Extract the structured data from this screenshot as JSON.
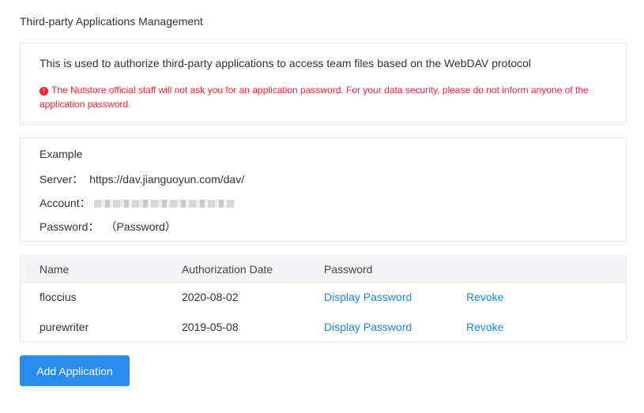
{
  "page": {
    "title": "Third-party Applications Management"
  },
  "info": {
    "description": "This is used to authorize third-party applications to access team files based on the WebDAV protocol",
    "warning": "The Nutstore official staff will not ask you for an application password. For your data security, please do not inform anyone of the application password.",
    "warning_color": "#f5222d"
  },
  "example": {
    "heading": "Example",
    "server_label": "Server：",
    "server_value": "https://dav.jianguoyun.com/dav/",
    "account_label": "Account：",
    "password_label": "Password：",
    "password_value": "（Password）"
  },
  "table": {
    "columns": [
      "Name",
      "Authorization Date",
      "Password"
    ],
    "rows": [
      {
        "name": "floccius",
        "date": "2020-08-02",
        "display": "Display Password",
        "revoke": "Revoke"
      },
      {
        "name": "purewriter",
        "date": "2019-05-08",
        "display": "Display Password",
        "revoke": "Revoke"
      }
    ]
  },
  "actions": {
    "add_label": "Add Application",
    "accent_color": "#2b8cf0",
    "link_color": "#1a86f0"
  }
}
